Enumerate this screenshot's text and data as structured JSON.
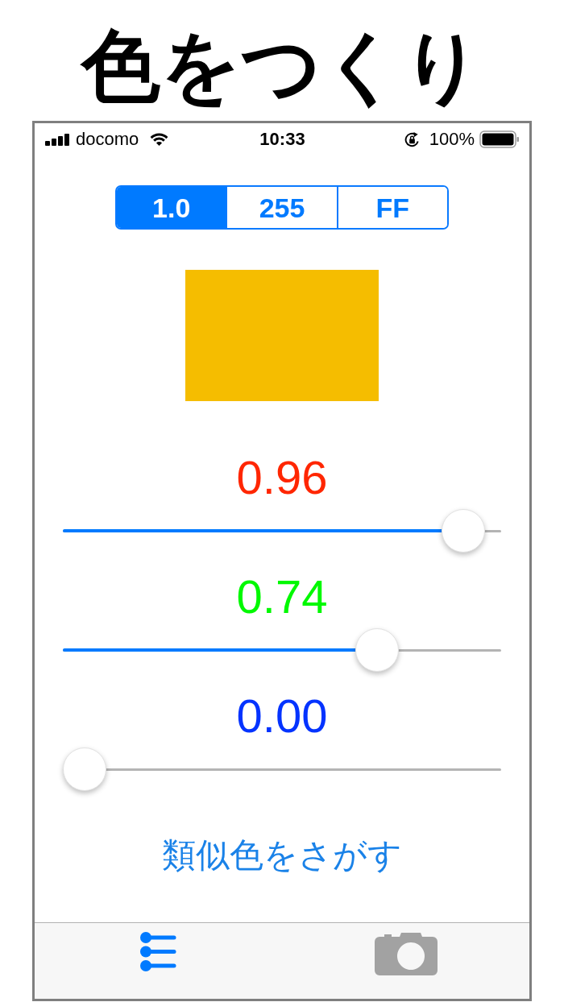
{
  "title": "色をつくり",
  "status_bar": {
    "carrier": "docomo",
    "time": "10:33",
    "battery": "100%"
  },
  "segments": [
    {
      "label": "1.0",
      "selected": true
    },
    {
      "label": "255",
      "selected": false
    },
    {
      "label": "FF",
      "selected": false
    }
  ],
  "sliders": [
    {
      "value": "0.96",
      "color": "#ff2600",
      "level": 0.96
    },
    {
      "value": "0.74",
      "color": "#00f900",
      "level": 0.74
    },
    {
      "value": "0.00",
      "color": "#0433ff",
      "level": 0
    }
  ],
  "button": "類似色をさがす",
  "tabs": [
    {
      "kind": "sliders",
      "selected": true
    },
    {
      "kind": "camera",
      "selected": false
    }
  ]
}
